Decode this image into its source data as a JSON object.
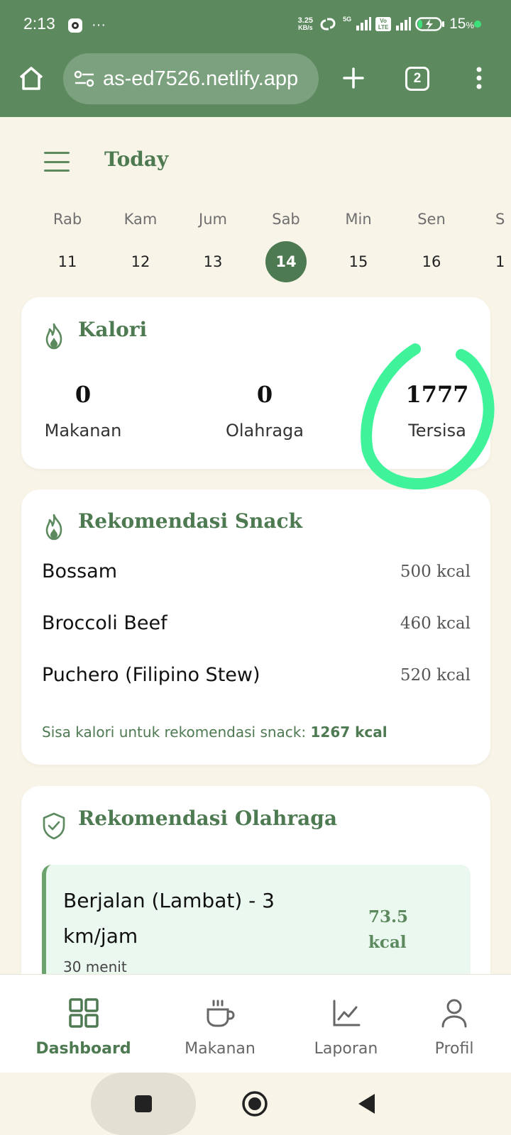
{
  "status_bar": {
    "time": "2:13",
    "more": "···",
    "speed_value": "3.25",
    "speed_unit": "KB/s",
    "network": "5G",
    "volte": "Vo LTE",
    "battery_value": "15",
    "battery_unit": "%"
  },
  "browser": {
    "url": "as-ed7526.netlify.app",
    "tab_count": "2"
  },
  "header": {
    "title": "Today"
  },
  "week": {
    "days": [
      {
        "name": "Rab",
        "num": "11"
      },
      {
        "name": "Kam",
        "num": "12"
      },
      {
        "name": "Jum",
        "num": "13"
      },
      {
        "name": "Sab",
        "num": "14"
      },
      {
        "name": "Min",
        "num": "15"
      },
      {
        "name": "Sen",
        "num": "16"
      },
      {
        "name": "S",
        "num": "1"
      }
    ],
    "selected": "14"
  },
  "kalori": {
    "title": "Kalori",
    "stats": [
      {
        "value": "0",
        "label": "Makanan"
      },
      {
        "value": "0",
        "label": "Olahraga"
      },
      {
        "value": "1777",
        "label": "Tersisa"
      }
    ],
    "highlight_color": "#3ef39a"
  },
  "snack": {
    "title": "Rekomendasi Snack",
    "items": [
      {
        "name": "Bossam",
        "kcal": "500 kcal"
      },
      {
        "name": "Broccoli Beef",
        "kcal": "460 kcal"
      },
      {
        "name": "Puchero (Filipino Stew)",
        "kcal": "520 kcal"
      }
    ],
    "note_prefix": "Sisa kalori untuk rekomendasi snack:",
    "note_value": "1267 kcal"
  },
  "olahraga": {
    "title": "Rekomendasi Olahraga",
    "items": [
      {
        "name": "Berjalan (Lambat) - 3 km/jam",
        "duration": "30 menit",
        "kcal": "73.5 kcal"
      }
    ]
  },
  "bottom_nav": {
    "items": [
      {
        "label": "Dashboard",
        "icon": "grid-icon",
        "active": true
      },
      {
        "label": "Makanan",
        "icon": "cup-icon",
        "active": false
      },
      {
        "label": "Laporan",
        "icon": "chart-icon",
        "active": false
      },
      {
        "label": "Profil",
        "icon": "user-icon",
        "active": false
      }
    ]
  },
  "colors": {
    "brand": "#5c8a5e",
    "brand_dark": "#4e7a52",
    "background": "#f8f4e8",
    "card": "#ffffff",
    "exercise_bg": "#ebf8ef"
  }
}
